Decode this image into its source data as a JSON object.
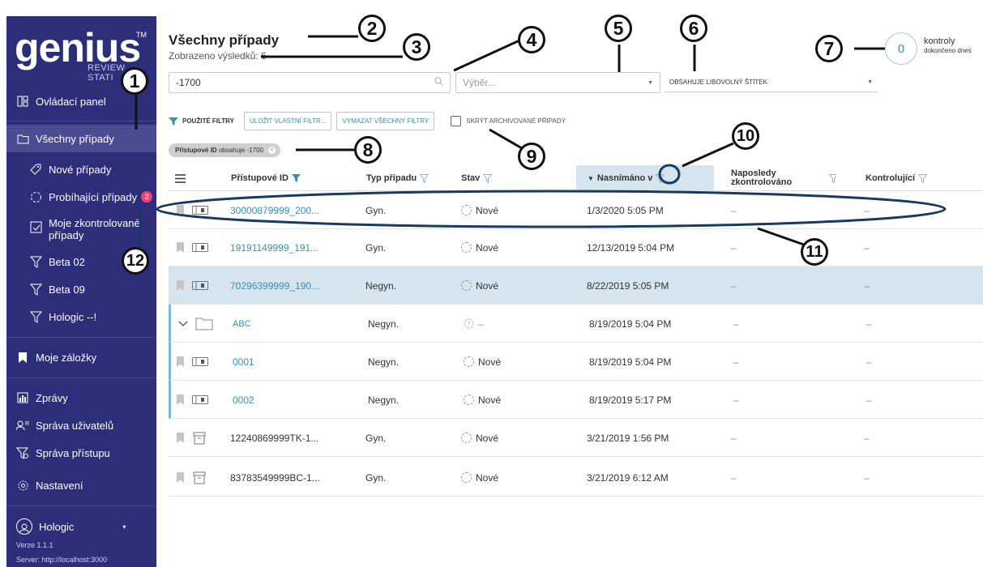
{
  "sidebar": {
    "logo_word": "genius",
    "logo_tm": "TM",
    "logo_sub": "REVIEW STATI",
    "items": [
      {
        "label": "Ovládací panel",
        "icon": "dashboard-icon"
      },
      {
        "label": "Všechny případy",
        "icon": "folder-icon"
      },
      {
        "label": "Nové případy",
        "icon": "tag-icon"
      },
      {
        "label": "Probíhající případy",
        "icon": "progress-icon",
        "badge": "2"
      },
      {
        "label": "Moje zkontrolované případy",
        "icon": "checkbox-icon"
      },
      {
        "label": "Beta 02",
        "icon": "filter-icon"
      },
      {
        "label": "Beta 09",
        "icon": "filter-icon"
      },
      {
        "label": "Hologic --!",
        "icon": "filter-icon"
      },
      {
        "label": "Moje záložky",
        "icon": "bookmark-icon"
      },
      {
        "label": "Zprávy",
        "icon": "chart-icon"
      },
      {
        "label": "Správa uživatelů",
        "icon": "users-icon"
      },
      {
        "label": "Správa přístupu",
        "icon": "access-icon"
      },
      {
        "label": "Nastavení",
        "icon": "gear-icon"
      }
    ],
    "user": "Hologic",
    "version": "Verze 1.1.1",
    "server": "Server: http://localhost:3000"
  },
  "header": {
    "title": "Všechny případy",
    "results": "Zobrazeno výsledků: 6"
  },
  "search": {
    "value": "-1700"
  },
  "select": {
    "placeholder": "Výběr..."
  },
  "label_select": {
    "value": "OBSAHUJE LIBOVOLNÝ ŠTÍTEK"
  },
  "filters": {
    "applied": "POUŽITÉ FILTRY",
    "save": "ULOŽIT VLASTNÍ FILTR...",
    "clear": "VYMAZAT VŠECHNY FILTRY",
    "hide_archived": "SKRÝT ARCHIVOVANÉ PŘÍPADY",
    "chip_key": "Přístupové ID",
    "chip_val": "obsahuje -1700"
  },
  "kontrol": {
    "count": "0",
    "label": "kontroly",
    "sub": "dokončeno dnes"
  },
  "table": {
    "columns": {
      "id": "Přístupové ID",
      "typ": "Typ případu",
      "stav": "Stav",
      "nasnimano": "Nasnímáno v",
      "naposledy": "Naposledy zkontrolováno",
      "kontrolujici": "Kontrolující"
    },
    "rows": [
      {
        "id": "30000879999_200...",
        "typ": "Gyn.",
        "stav": "Nové",
        "date": "1/3/2020 5:05 PM",
        "last": "–",
        "rev": "–",
        "kind": "case"
      },
      {
        "id": "19191149999_191...",
        "typ": "Gyn.",
        "stav": "Nové",
        "date": "12/13/2019 5:04 PM",
        "last": "–",
        "rev": "–",
        "kind": "case"
      },
      {
        "id": "70296399999_190...",
        "typ": "Negyn.",
        "stav": "Nové",
        "date": "8/22/2019 5:05 PM",
        "last": "–",
        "rev": "–",
        "kind": "case"
      },
      {
        "id": "ABC",
        "typ": "Negyn.",
        "stav": "–",
        "date": "8/19/2019 5:04 PM",
        "last": "–",
        "rev": "–",
        "kind": "folder"
      },
      {
        "id": "0001",
        "typ": "Negyn.",
        "stav": "Nové",
        "date": "8/19/2019 5:04 PM",
        "last": "–",
        "rev": "–",
        "kind": "child"
      },
      {
        "id": "0002",
        "typ": "Negyn.",
        "stav": "Nové",
        "date": "8/19/2019 5:17 PM",
        "last": "–",
        "rev": "–",
        "kind": "child"
      },
      {
        "id": "12240869999TK-1...",
        "typ": "Gyn.",
        "stav": "Nové",
        "date": "3/21/2019 1:56 PM",
        "last": "–",
        "rev": "–",
        "kind": "archived"
      },
      {
        "id": "83783549999BC-1...",
        "typ": "Gyn.",
        "stav": "Nové",
        "date": "3/21/2019 6:12 AM",
        "last": "–",
        "rev": "–",
        "kind": "archived"
      }
    ]
  },
  "callouts": [
    "1",
    "2",
    "3",
    "4",
    "5",
    "6",
    "7",
    "8",
    "9",
    "10",
    "11",
    "12"
  ]
}
